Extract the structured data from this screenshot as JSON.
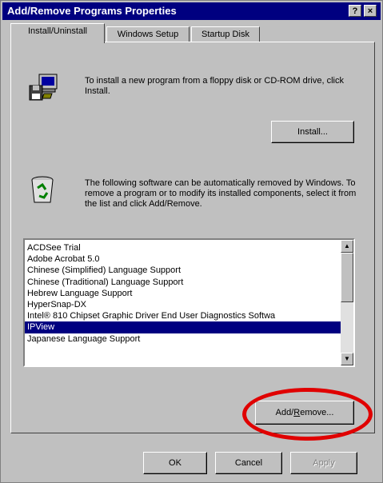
{
  "window": {
    "title": "Add/Remove Programs Properties",
    "help_button": "?",
    "close_button": "×"
  },
  "tabs": [
    {
      "label": "Install/Uninstall",
      "active": true
    },
    {
      "label": "Windows Setup",
      "active": false
    },
    {
      "label": "Startup Disk",
      "active": false
    }
  ],
  "install_section": {
    "icon": "computer-floppy-icon",
    "description": "To install a new program from a floppy disk or CD-ROM drive, click Install.",
    "button_label": "Install..."
  },
  "remove_section": {
    "icon": "recycle-bin-icon",
    "description": "The following software can be automatically removed by Windows. To remove a program or to modify its installed components, select it from the list and click Add/Remove."
  },
  "program_list": {
    "items": [
      "ACDSee Trial",
      "Adobe Acrobat 5.0",
      "Chinese (Simplified) Language Support",
      "Chinese (Traditional) Language Support",
      "Hebrew Language Support",
      "HyperSnap-DX",
      "Intel® 810 Chipset Graphic Driver End User Diagnostics Softwa",
      "IPView",
      "Japanese Language Support"
    ],
    "selected_index": 7
  },
  "add_remove_button": {
    "label_prefix": "Add/",
    "label_underline": "R",
    "label_suffix": "emove..."
  },
  "footer": {
    "ok": "OK",
    "cancel": "Cancel",
    "apply": "Apply"
  },
  "colors": {
    "titlebar": "#000080",
    "selection": "#000080",
    "annotation": "#e00000"
  }
}
